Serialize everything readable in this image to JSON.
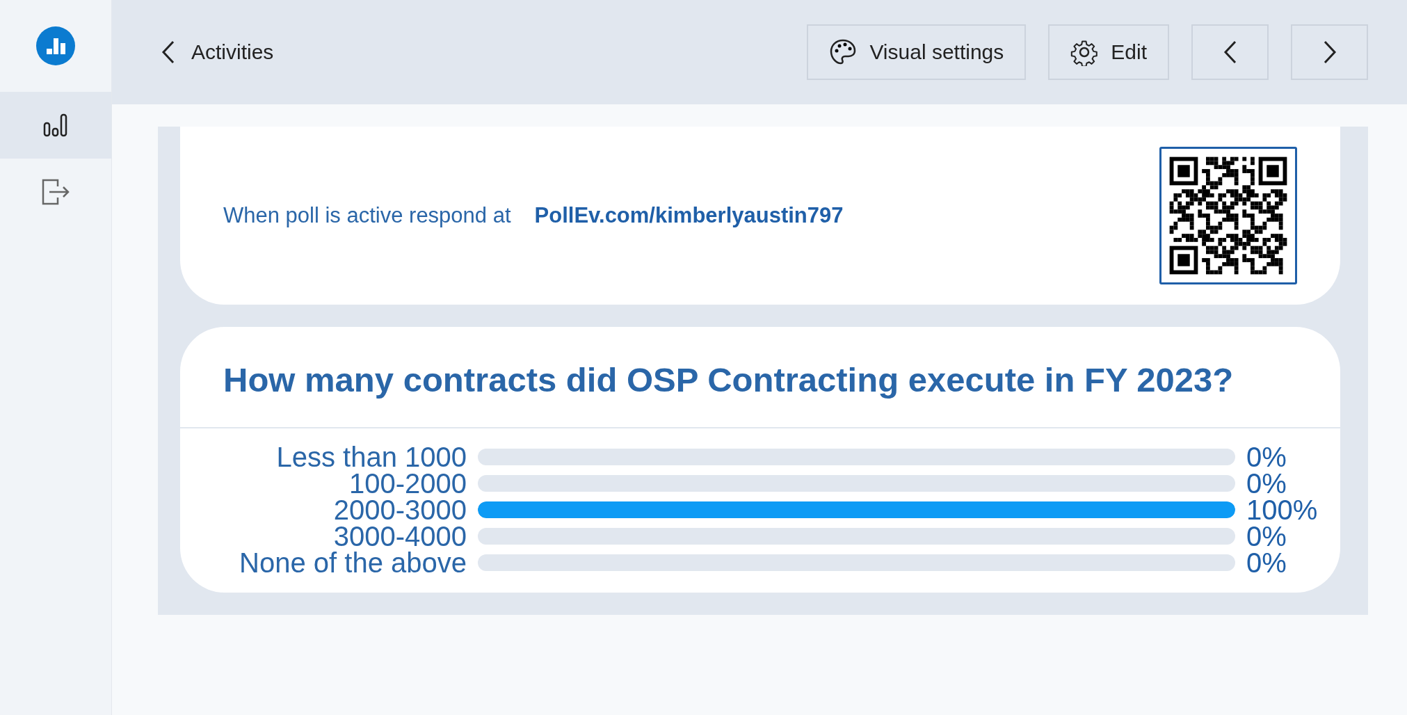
{
  "sidebar": {
    "items": [
      {
        "kind": "results",
        "selected": true
      },
      {
        "kind": "logout",
        "selected": false
      }
    ]
  },
  "top_bar": {
    "back_link": "Activities",
    "buttons": [
      {
        "kind": "palette",
        "label": "Visual settings"
      },
      {
        "kind": "gear",
        "label": "Edit"
      },
      {
        "kind": "prev"
      },
      {
        "kind": "next"
      }
    ]
  },
  "respond_card": {
    "instruction": "When poll is active respond at",
    "url": "PollEv.com/kimberlyaustin797"
  },
  "poll": {
    "question": "How many contracts did OSP Contracting execute in FY 2023?",
    "options": [
      {
        "label": "Less than 1000",
        "level": 0,
        "reading": "0%"
      },
      {
        "label": "100-2000",
        "level": 0,
        "reading": "0%"
      },
      {
        "label": "2000-3000",
        "level": 1,
        "reading": "100%"
      },
      {
        "label": "3000-4000",
        "level": 0,
        "reading": "0%"
      },
      {
        "label": "None of the above",
        "level": 0,
        "reading": "0%"
      }
    ]
  }
}
